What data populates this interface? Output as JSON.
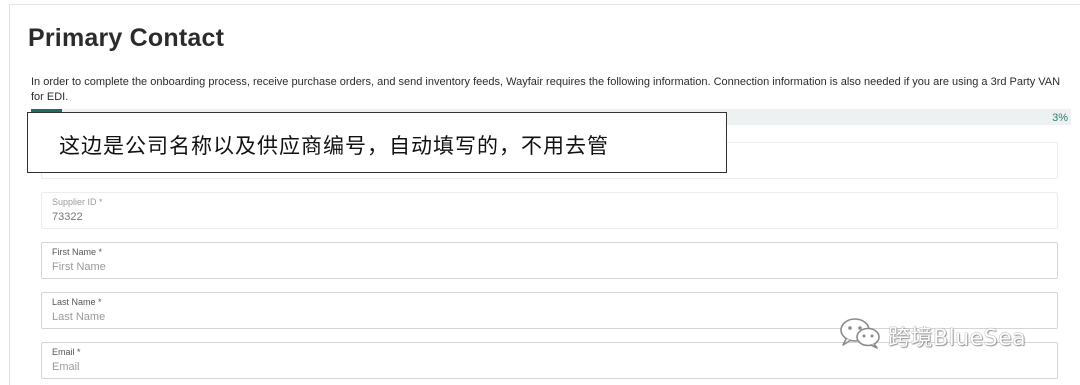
{
  "page": {
    "title": "Primary Contact",
    "intro": "In order to complete the onboarding process, receive purchase orders, and send inventory feeds, Wayfair requires the following information. Connection information is also needed if you are using a 3rd Party VAN for EDI."
  },
  "progress": {
    "percent_label": "3%",
    "fraction": 0.03,
    "fill_color": "#1f6b5e"
  },
  "annotation": {
    "text": "这边是公司名称以及供应商编号，自动填写的，不用去管"
  },
  "form": {
    "supplier_id": {
      "label": "Supplier ID *",
      "value": "73322"
    },
    "first_name": {
      "label": "First Name *",
      "placeholder": "First Name"
    },
    "last_name": {
      "label": "Last Name *",
      "placeholder": "Last Name"
    },
    "email": {
      "label": "Email *",
      "placeholder": "Email"
    }
  },
  "watermark": {
    "icon": "wechat-icon",
    "text": "跨境BlueSea"
  }
}
